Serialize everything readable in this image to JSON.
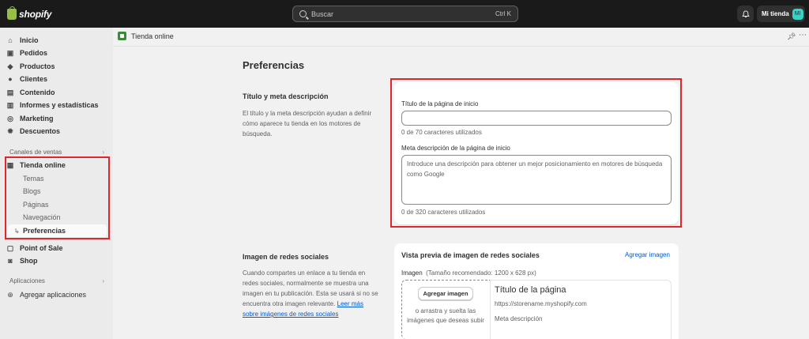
{
  "topbar": {
    "brand": "shopify",
    "search_placeholder": "Buscar",
    "search_shortcut": "Ctrl K",
    "store_name": "Mi tienda",
    "avatar_initials": "MI"
  },
  "sidebar": {
    "items": [
      {
        "label": "Inicio",
        "icon": "home-icon"
      },
      {
        "label": "Pedidos",
        "icon": "inbox-icon"
      },
      {
        "label": "Productos",
        "icon": "tag-icon"
      },
      {
        "label": "Clientes",
        "icon": "person-icon"
      },
      {
        "label": "Contenido",
        "icon": "document-icon"
      },
      {
        "label": "Informes y estadísticas",
        "icon": "bar-chart-icon"
      },
      {
        "label": "Marketing",
        "icon": "target-icon"
      },
      {
        "label": "Descuentos",
        "icon": "discount-icon"
      }
    ],
    "sales_channels_title": "Canales de ventas",
    "online_store": "Tienda online",
    "online_store_sub": [
      "Temas",
      "Blogs",
      "Páginas",
      "Navegación",
      "Preferencias"
    ],
    "pos": "Point of Sale",
    "shop": "Shop",
    "apps_title": "Aplicaciones",
    "add_apps": "Agregar aplicaciones"
  },
  "breadcrumb": {
    "label": "Tienda online"
  },
  "page": {
    "title": "Preferencias",
    "meta_section": {
      "heading": "Título y meta descripción",
      "description": "El título y la meta descripción ayudan a definir cómo aparece tu tienda en los motores de búsqueda.",
      "title_label": "Título de la página de inicio",
      "title_value": "",
      "title_help": "0 de 70 caracteres utilizados",
      "desc_label": "Meta descripción de la página de inicio",
      "desc_placeholder": "Introduce una descripción para obtener un mejor posicionamiento en motores de búsqueda como Google",
      "desc_help": "0 de 320 caracteres utilizados"
    },
    "social_section": {
      "heading": "Imagen de redes sociales",
      "description": "Cuando compartes un enlace a tu tienda en redes sociales, normalmente se muestra una imagen en tu publicación. Esta se usará si no se encuentra otra imagen relevante.",
      "link_text": "Leer más sobre imágenes de redes sociales",
      "card_title": "Vista previa de imagen de redes sociales",
      "add_image_link": "Agregar imagen",
      "image_label": "Imagen",
      "image_hint": "(Tamaño recomendado: 1200 x 628 px)",
      "add_image_button": "Agregar imagen",
      "drop_text": "o arrastra y suelta las imágenes que deseas subir",
      "preview_title": "Título de la página",
      "preview_url": "https://storename.myshopify.com",
      "preview_desc": "Meta descripción"
    }
  },
  "colors": {
    "highlight": "#e0252b",
    "link": "#005bd3",
    "topbar": "#1a1a1a"
  }
}
